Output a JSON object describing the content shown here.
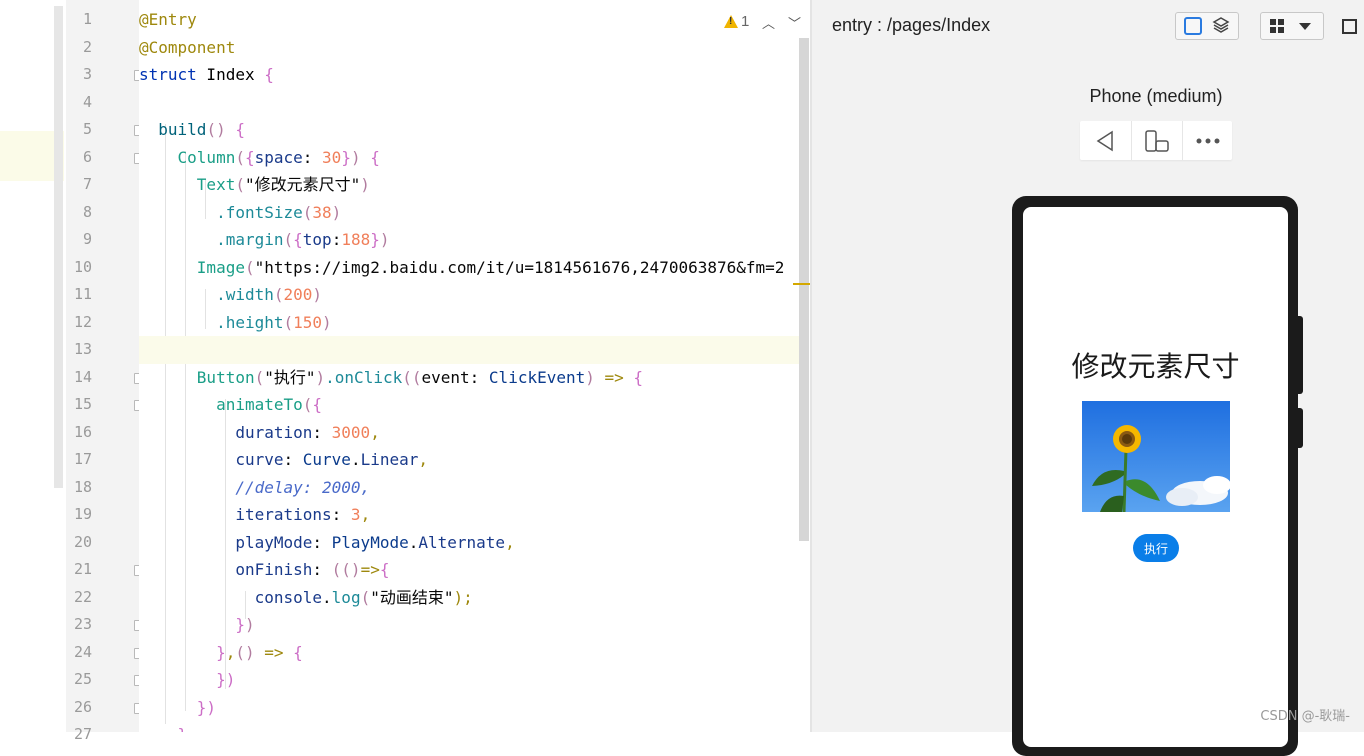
{
  "editor": {
    "line_numbers": [
      "1",
      "2",
      "3",
      "4",
      "5",
      "6",
      "7",
      "8",
      "9",
      "10",
      "11",
      "12",
      "13",
      "14",
      "15",
      "16",
      "17",
      "18",
      "19",
      "20",
      "21",
      "22",
      "23",
      "24",
      "25",
      "26",
      "27"
    ],
    "lines": [
      [
        {
          "t": "@Entry",
          "c": "t-ann"
        }
      ],
      [
        {
          "t": "@Component",
          "c": "t-ann"
        }
      ],
      [
        {
          "t": "struct",
          "c": "t-kw"
        },
        {
          "t": " Index ",
          "c": "t-cls"
        },
        {
          "t": "{",
          "c": "t-br"
        }
      ],
      [],
      [
        {
          "t": "  build",
          "c": "t-fn"
        },
        {
          "t": "() ",
          "c": "t-pr"
        },
        {
          "t": "{",
          "c": "t-br"
        }
      ],
      [
        {
          "t": "    Column",
          "c": "t-comp"
        },
        {
          "t": "(",
          "c": "t-pr"
        },
        {
          "t": "{",
          "c": "t-br"
        },
        {
          "t": "space",
          "c": "t-field"
        },
        {
          "t": ": ",
          "c": "t-plain"
        },
        {
          "t": "30",
          "c": "t-num"
        },
        {
          "t": "}",
          "c": "t-br"
        },
        {
          "t": ") ",
          "c": "t-pr"
        },
        {
          "t": "{",
          "c": "t-br"
        }
      ],
      [
        {
          "t": "      Text",
          "c": "t-comp"
        },
        {
          "t": "(",
          "c": "t-pr"
        },
        {
          "t": "\"修改元素尺寸\"",
          "c": "t-plain"
        },
        {
          "t": ")",
          "c": "t-pr"
        }
      ],
      [
        {
          "t": "        .fontSize",
          "c": "t-meth"
        },
        {
          "t": "(",
          "c": "t-pr"
        },
        {
          "t": "38",
          "c": "t-num"
        },
        {
          "t": ")",
          "c": "t-pr"
        }
      ],
      [
        {
          "t": "        .margin",
          "c": "t-meth"
        },
        {
          "t": "(",
          "c": "t-pr"
        },
        {
          "t": "{",
          "c": "t-br"
        },
        {
          "t": "top",
          "c": "t-field"
        },
        {
          "t": ":",
          "c": "t-plain"
        },
        {
          "t": "188",
          "c": "t-num"
        },
        {
          "t": "}",
          "c": "t-br"
        },
        {
          "t": ")",
          "c": "t-pr"
        }
      ],
      [
        {
          "t": "      Image",
          "c": "t-comp"
        },
        {
          "t": "(",
          "c": "t-pr"
        },
        {
          "t": "\"https://img2.baidu.com/it/u=1814561676,2470063876&fm=2",
          "c": "t-plain"
        }
      ],
      [
        {
          "t": "        .width",
          "c": "t-meth"
        },
        {
          "t": "(",
          "c": "t-pr"
        },
        {
          "t": "200",
          "c": "t-num"
        },
        {
          "t": ")",
          "c": "t-pr"
        }
      ],
      [
        {
          "t": "        .height",
          "c": "t-meth"
        },
        {
          "t": "(",
          "c": "t-pr"
        },
        {
          "t": "150",
          "c": "t-num"
        },
        {
          "t": ")",
          "c": "t-pr"
        }
      ],
      [],
      [
        {
          "t": "      Button",
          "c": "t-comp"
        },
        {
          "t": "(",
          "c": "t-pr"
        },
        {
          "t": "\"执行\"",
          "c": "t-plain"
        },
        {
          "t": ")",
          "c": "t-pr"
        },
        {
          "t": ".onClick",
          "c": "t-meth"
        },
        {
          "t": "((",
          "c": "t-pr"
        },
        {
          "t": "event",
          "c": "t-plain"
        },
        {
          "t": ": ",
          "c": "t-plain"
        },
        {
          "t": "ClickEvent",
          "c": "t-type"
        },
        {
          "t": ") ",
          "c": "t-pr"
        },
        {
          "t": "=> ",
          "c": "t-ann"
        },
        {
          "t": "{",
          "c": "t-br"
        }
      ],
      [
        {
          "t": "        animateTo",
          "c": "t-comp"
        },
        {
          "t": "(",
          "c": "t-pr"
        },
        {
          "t": "{",
          "c": "t-br"
        }
      ],
      [
        {
          "t": "          duration",
          "c": "t-field"
        },
        {
          "t": ": ",
          "c": "t-plain"
        },
        {
          "t": "3000",
          "c": "t-num"
        },
        {
          "t": ",",
          "c": "t-ann"
        }
      ],
      [
        {
          "t": "          curve",
          "c": "t-field"
        },
        {
          "t": ": ",
          "c": "t-plain"
        },
        {
          "t": "Curve",
          "c": "t-type"
        },
        {
          "t": ".",
          "c": "t-plain"
        },
        {
          "t": "Linear",
          "c": "t-field"
        },
        {
          "t": ",",
          "c": "t-ann"
        }
      ],
      [
        {
          "t": "          //delay: 2000,",
          "c": "t-cm"
        }
      ],
      [
        {
          "t": "          iterations",
          "c": "t-field"
        },
        {
          "t": ": ",
          "c": "t-plain"
        },
        {
          "t": "3",
          "c": "t-num"
        },
        {
          "t": ",",
          "c": "t-ann"
        }
      ],
      [
        {
          "t": "          playMode",
          "c": "t-field"
        },
        {
          "t": ": ",
          "c": "t-plain"
        },
        {
          "t": "PlayMode",
          "c": "t-type"
        },
        {
          "t": ".",
          "c": "t-plain"
        },
        {
          "t": "Alternate",
          "c": "t-field"
        },
        {
          "t": ",",
          "c": "t-ann"
        }
      ],
      [
        {
          "t": "          onFinish",
          "c": "t-field"
        },
        {
          "t": ": ",
          "c": "t-plain"
        },
        {
          "t": "(()",
          "c": "t-pr"
        },
        {
          "t": "=>",
          "c": "t-ann"
        },
        {
          "t": "{",
          "c": "t-br"
        }
      ],
      [
        {
          "t": "            console",
          "c": "t-field"
        },
        {
          "t": ".",
          "c": "t-plain"
        },
        {
          "t": "log",
          "c": "t-meth"
        },
        {
          "t": "(",
          "c": "t-pr"
        },
        {
          "t": "\"动画结束\"",
          "c": "t-plain"
        },
        {
          "t": ");",
          "c": "t-ann"
        }
      ],
      [
        {
          "t": "          ",
          "c": "t-plain"
        },
        {
          "t": "}",
          "c": "t-br"
        },
        {
          "t": ")",
          "c": "t-pr"
        }
      ],
      [
        {
          "t": "        ",
          "c": "t-plain"
        },
        {
          "t": "}",
          "c": "t-br"
        },
        {
          "t": ",",
          "c": "t-ann"
        },
        {
          "t": "() ",
          "c": "t-pr"
        },
        {
          "t": "=> ",
          "c": "t-ann"
        },
        {
          "t": "{",
          "c": "t-br"
        }
      ],
      [
        {
          "t": "        ",
          "c": "t-plain"
        },
        {
          "t": "})",
          "c": "t-br"
        }
      ],
      [
        {
          "t": "      ",
          "c": "t-plain"
        },
        {
          "t": "})",
          "c": "t-br"
        }
      ],
      [
        {
          "t": "    ",
          "c": "t-plain"
        },
        {
          "t": "}",
          "c": "t-br"
        }
      ]
    ],
    "current_line": 13,
    "fold_lines": [
      3,
      5,
      6,
      14,
      15,
      21,
      23,
      24,
      25,
      26
    ],
    "warning_count": "1"
  },
  "preview": {
    "title": "entry : /pages/Index",
    "device_name": "Phone (medium)",
    "app": {
      "title": "修改元素尺寸",
      "button_label": "执行"
    }
  },
  "watermark": "CSDN @-耿瑞-",
  "colors": {
    "accent_blue": "#0a7ee8",
    "tab_indicator": "#4a8ee0",
    "warning": "#f0b400"
  }
}
